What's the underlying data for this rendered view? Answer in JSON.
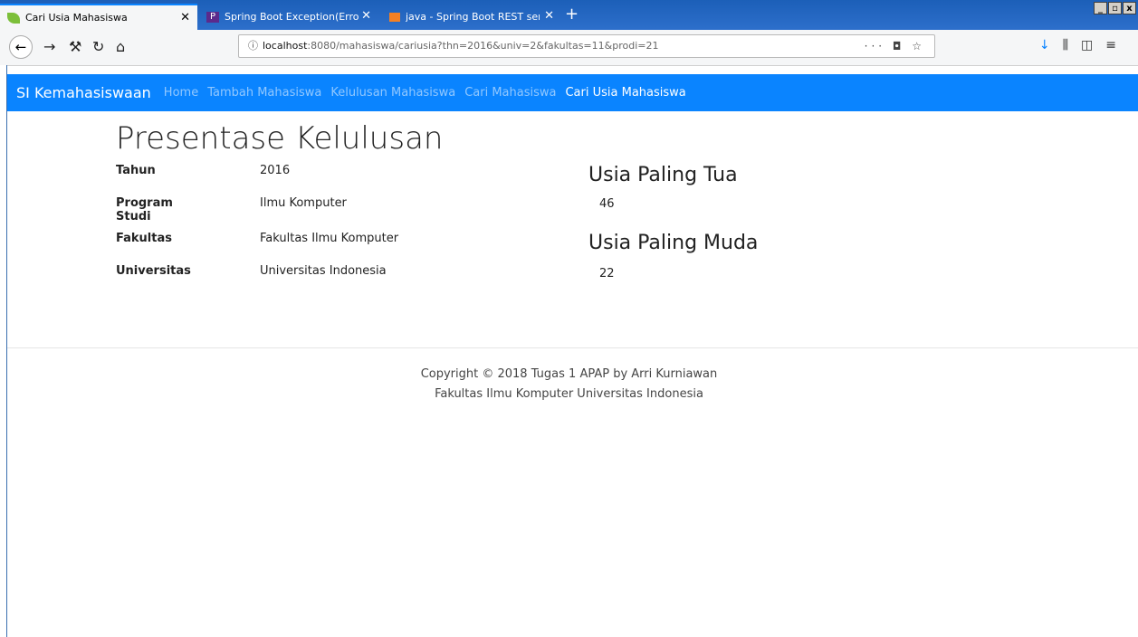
{
  "browser": {
    "tabs": [
      {
        "title": "Cari Usia Mahasiswa",
        "active": true
      },
      {
        "title": "Spring Boot Exception(Error) Hand",
        "active": false
      },
      {
        "title": "java - Spring Boot REST service ex",
        "active": false
      }
    ],
    "url_host": "localhost",
    "url_rest": ":8080/mahasiswa/cariusia?thn=2016&univ=2&fakultas=11&prodi=21",
    "url_actions": "··· ◘ ☆"
  },
  "app": {
    "brand": "SI Kemahasiswaan",
    "nav": [
      "Home",
      "Tambah Mahasiswa",
      "Kelulusan Mahasiswa",
      "Cari Mahasiswa",
      "Cari Usia Mahasiswa"
    ]
  },
  "main": {
    "title": "Presentase Kelulusan",
    "details": [
      {
        "key": "Tahun",
        "value": "2016"
      },
      {
        "key": "Program Studi",
        "value": "Ilmu Komputer"
      },
      {
        "key": "Fakultas",
        "value": "Fakultas Ilmu Komputer"
      },
      {
        "key": "Universitas",
        "value": "Universitas Indonesia"
      }
    ],
    "oldest_label": "Usia Paling Tua",
    "oldest_value": "46",
    "youngest_label": "Usia Paling Muda",
    "youngest_value": "22"
  },
  "footer": {
    "line1": "Copyright © 2018 Tugas 1 APAP by Arri Kurniawan",
    "line2": "Fakultas Ilmu Komputer Universitas Indonesia"
  },
  "colors": {
    "navbar": "#0a84ff",
    "tabbar": "#2d6fcb"
  }
}
